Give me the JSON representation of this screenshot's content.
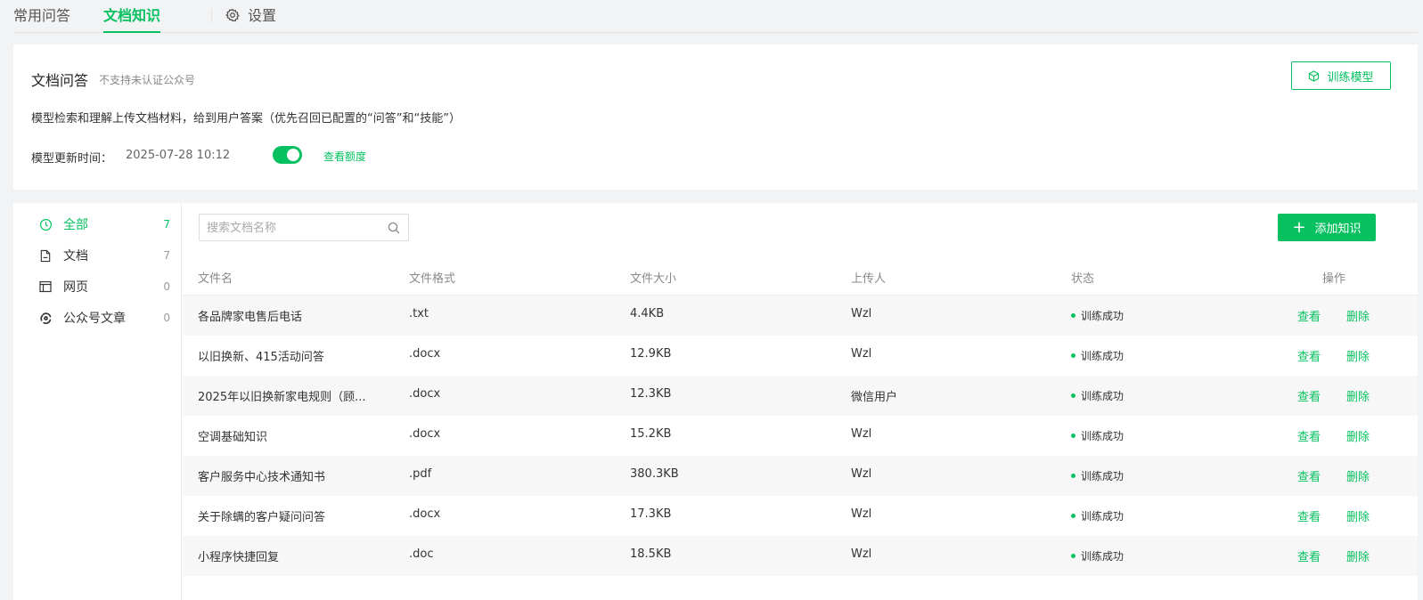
{
  "tabs": {
    "faq": "常用问答",
    "doc": "文档知识",
    "settings": "设置"
  },
  "card": {
    "title": "文档问答",
    "note": "不支持未认证公众号",
    "description": "模型检索和理解上传文档材料，给到用户答案（优先召回已配置的“问答”和“技能”）",
    "update_label": "模型更新时间：",
    "update_value": "2025-07-28 10:12",
    "toggle_on": true,
    "quota_link": "查看额度",
    "train_button": "训练模型"
  },
  "sidebar": {
    "items": [
      {
        "label": "全部",
        "count": "7",
        "icon": "clock-icon"
      },
      {
        "label": "文档",
        "count": "7",
        "icon": "document-icon"
      },
      {
        "label": "网页",
        "count": "0",
        "icon": "webpage-icon"
      },
      {
        "label": "公众号文章",
        "count": "0",
        "icon": "official-account-icon"
      }
    ]
  },
  "search": {
    "placeholder": "搜索文档名称"
  },
  "add_button": "添加知识",
  "table": {
    "headers": {
      "name": "文件名",
      "format": "文件格式",
      "size": "文件大小",
      "uploader": "上传人",
      "status": "状态",
      "actions": "操作"
    },
    "view_label": "查看",
    "delete_label": "删除",
    "rows": [
      {
        "name": "各品牌家电售后电话",
        "format": ".txt",
        "size": "4.4KB",
        "uploader": "Wzl",
        "status": "训练成功"
      },
      {
        "name": "以旧换新、415活动问答",
        "format": ".docx",
        "size": "12.9KB",
        "uploader": "Wzl",
        "status": "训练成功"
      },
      {
        "name": "2025年以旧换新家电规则（顾...",
        "format": ".docx",
        "size": "12.3KB",
        "uploader": "微信用户",
        "status": "训练成功"
      },
      {
        "name": "空调基础知识",
        "format": ".docx",
        "size": "15.2KB",
        "uploader": "Wzl",
        "status": "训练成功"
      },
      {
        "name": "客户服务中心技术通知书",
        "format": ".pdf",
        "size": "380.3KB",
        "uploader": "Wzl",
        "status": "训练成功"
      },
      {
        "name": "关于除螨的客户疑问问答",
        "format": ".docx",
        "size": "17.3KB",
        "uploader": "Wzl",
        "status": "训练成功"
      },
      {
        "name": "小程序快捷回复",
        "format": ".doc",
        "size": "18.5KB",
        "uploader": "Wzl",
        "status": "训练成功"
      }
    ]
  },
  "colors": {
    "accent": "#07c160"
  }
}
